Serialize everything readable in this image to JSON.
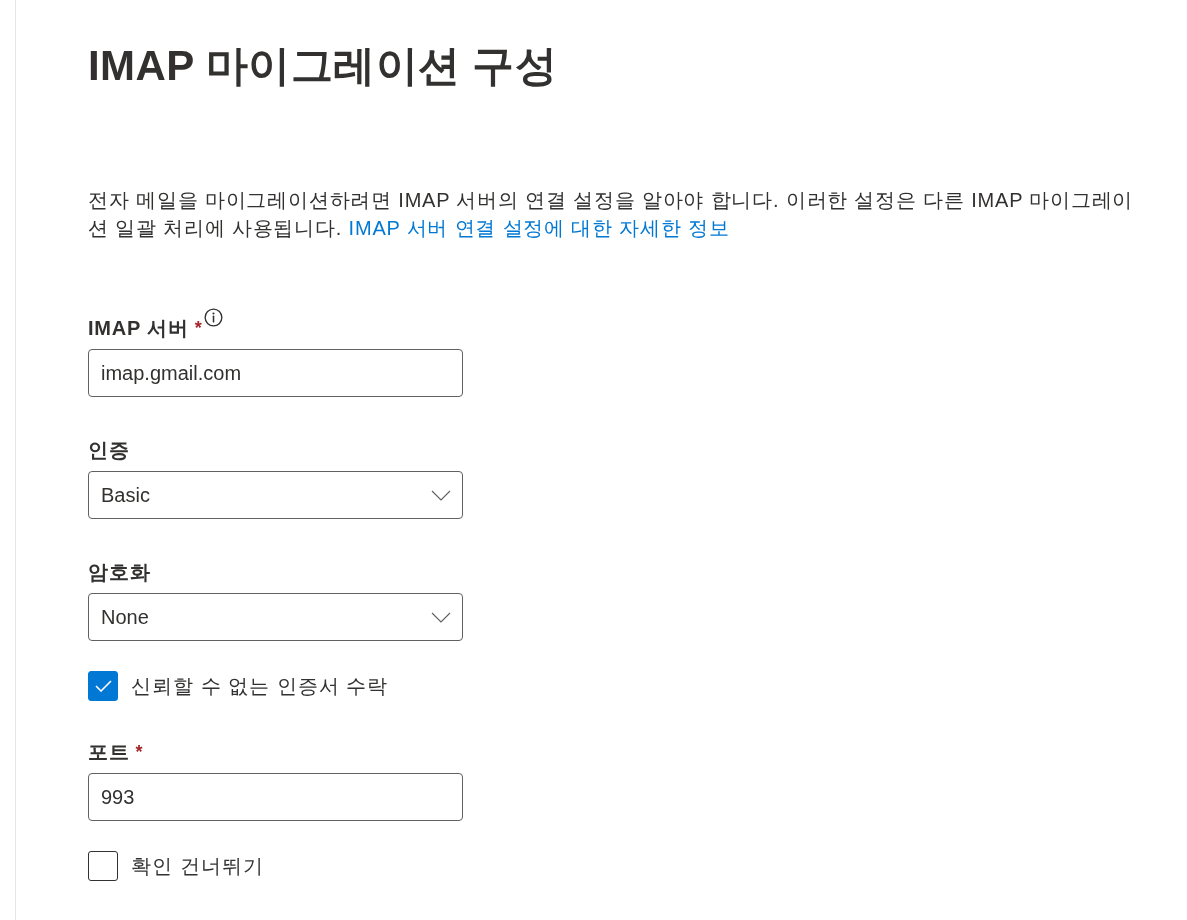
{
  "page": {
    "title": "IMAP 마이그레이션 구성",
    "description": {
      "text": "전자 메일을 마이그레이션하려면 IMAP 서버의 연결 설정을 알아야 합니다. 이러한 설정은 다른 IMAP 마이그레이션 일괄 처리에 사용됩니다. ",
      "link": "IMAP 서버 연결 설정에 대한 자세한 정보"
    }
  },
  "fields": [
    {
      "kind": "text",
      "label": "IMAP 서버",
      "required_mark": "*",
      "info": true,
      "value": "imap.gmail.com"
    },
    {
      "kind": "select",
      "label": "인증",
      "info": false,
      "value": "Basic"
    },
    {
      "kind": "select",
      "label": "암호화",
      "info": false,
      "value": "None"
    },
    {
      "kind": "checkbox",
      "label": "신뢰할 수 없는 인증서 수락",
      "checked": true
    },
    {
      "kind": "text",
      "label": "포트",
      "required_mark": "*",
      "info": false,
      "value": "993"
    },
    {
      "kind": "checkbox",
      "label": "확인 건너뛰기",
      "checked": false
    }
  ]
}
